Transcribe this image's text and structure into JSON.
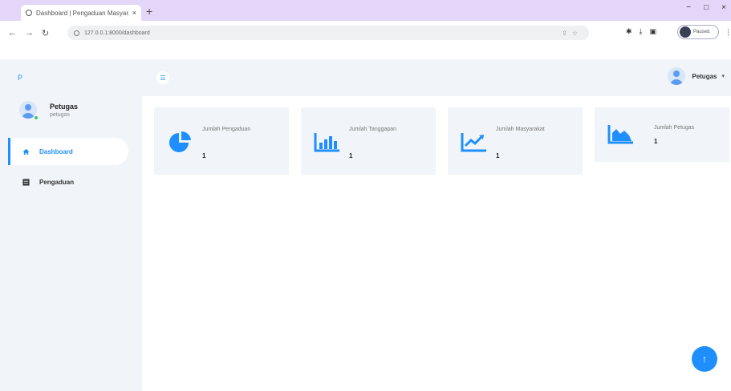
{
  "browser": {
    "tab_title": "Dashboard | Pengaduan Masyar...",
    "tab_close": "×",
    "new_tab": "+",
    "url": "127.0.0.1:8000/dashboard",
    "profile_label": "Paused",
    "win_min": "−",
    "win_max": "□",
    "win_close": "×"
  },
  "sidebar": {
    "brand": "P",
    "user_name": "Petugas",
    "user_role": "petugas",
    "items": [
      {
        "label": "Dashboard",
        "icon": "home-icon",
        "active": true
      },
      {
        "label": "Pengaduan",
        "icon": "grid-icon",
        "active": false
      }
    ]
  },
  "topbar": {
    "user_label": "Petugas",
    "chevron": "▾"
  },
  "cards": [
    {
      "label": "Jumlah Pengaduan",
      "value": "1",
      "icon": "pie-chart-icon"
    },
    {
      "label": "Jumlah Tanggapan",
      "value": "1",
      "icon": "bar-chart-icon"
    },
    {
      "label": "Jumlah Masyarakat",
      "value": "1",
      "icon": "line-chart-icon"
    },
    {
      "label": "Jumlah Petugas",
      "value": "1",
      "icon": "area-chart-icon"
    }
  ],
  "colors": {
    "accent": "#1f8fff",
    "panel": "#f1f4f8"
  },
  "fab_label": "↑"
}
